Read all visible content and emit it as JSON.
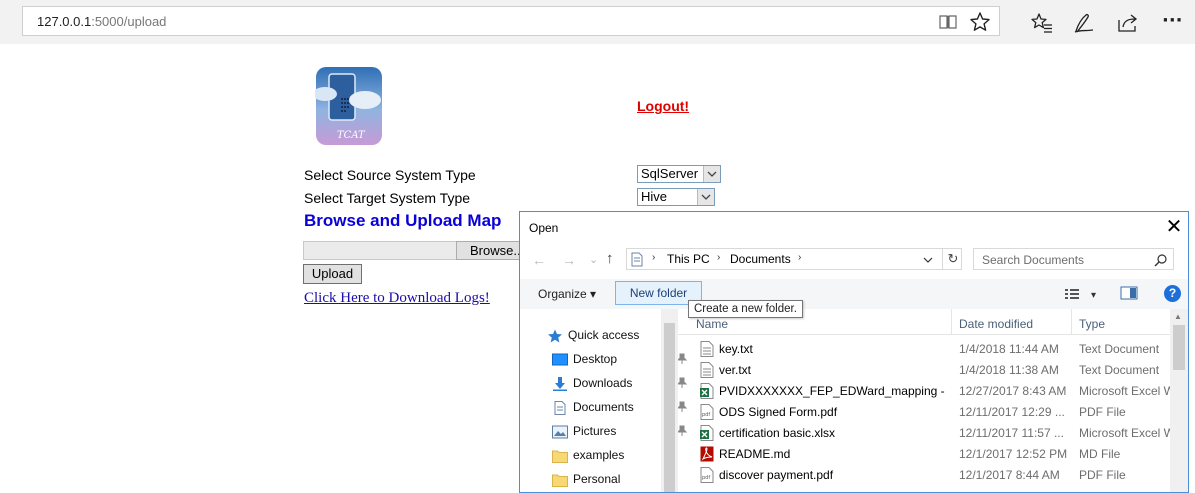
{
  "browser": {
    "url_host": "127.0.0.1",
    "url_path": ":5000/upload",
    "icons": [
      "reading-view-icon",
      "favorite-star-icon",
      "favorites-hub-icon",
      "pen-icon",
      "share-icon",
      "more-icon"
    ],
    "more_label": "···"
  },
  "page": {
    "logo_text": "TCAT",
    "logout_label": "Logout!",
    "source_label": "Select Source System Type",
    "source_value": "SqlServer",
    "target_label": "Select Target System Type",
    "target_value": "Hive",
    "heading": "Browse and Upload Map",
    "browse_label": "Browse...",
    "upload_label": "Upload",
    "download_link": "Click Here to Download Logs!"
  },
  "dialog": {
    "title": "Open",
    "close_label": "✕",
    "back_glyph": "←",
    "forward_glyph": "→",
    "recent_glyph": "⌄",
    "up_glyph": "↑",
    "refresh_glyph": "↻",
    "path": [
      "This PC",
      "Documents"
    ],
    "path_sep": "›",
    "search_placeholder": "Search Documents",
    "organize_label": "Organize ▾",
    "new_folder_label": "New folder",
    "tooltip": "Create a new folder.",
    "help_label": "?",
    "view_dropdown_glyph": "▾",
    "nav_items": [
      {
        "label": "Quick access",
        "icon": "quick-access-star-icon",
        "pinned": false
      },
      {
        "label": "Desktop",
        "icon": "desktop-icon",
        "pinned": true
      },
      {
        "label": "Downloads",
        "icon": "downloads-icon",
        "pinned": true
      },
      {
        "label": "Documents",
        "icon": "documents-icon",
        "pinned": true
      },
      {
        "label": "Pictures",
        "icon": "pictures-icon",
        "pinned": true
      },
      {
        "label": "examples",
        "icon": "folder-icon",
        "pinned": false
      },
      {
        "label": "Personal",
        "icon": "folder-icon",
        "pinned": false
      }
    ],
    "columns": {
      "name": "Name",
      "date": "Date modified",
      "type": "Type"
    },
    "files": [
      {
        "name": "key.txt",
        "date": "1/4/2018 11:44 AM",
        "type": "Text Document",
        "icon": "text-file-icon"
      },
      {
        "name": "ver.txt",
        "date": "1/4/2018 11:38 AM",
        "type": "Text Document",
        "icon": "text-file-icon"
      },
      {
        "name": "PVIDXXXXXXX_FEP_EDWard_mapping - S...",
        "date": "12/27/2017 8:43 AM",
        "type": "Microsoft Excel W",
        "icon": "excel-file-icon"
      },
      {
        "name": "ODS Signed Form.pdf",
        "date": "12/11/2017 12:29 ...",
        "type": "PDF File",
        "icon": "pdf-file-icon"
      },
      {
        "name": "certification basic.xlsx",
        "date": "12/11/2017 11:57 ...",
        "type": "Microsoft Excel W",
        "icon": "excel-file-icon"
      },
      {
        "name": "README.md",
        "date": "12/1/2017 12:52 PM",
        "type": "MD File",
        "icon": "acrobat-file-icon"
      },
      {
        "name": "discover payment.pdf",
        "date": "12/1/2017 8:44 AM",
        "type": "PDF File",
        "icon": "pdf-file-icon"
      }
    ]
  }
}
